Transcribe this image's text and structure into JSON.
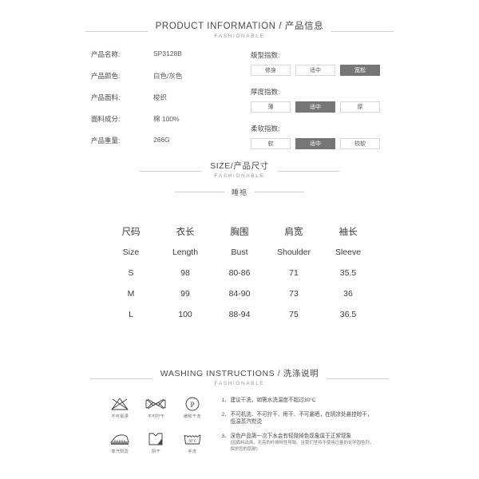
{
  "sections": {
    "product_information": {
      "title": "PRODUCT INFORMATION / 产品信息",
      "subtitle": "FASHIONABLE"
    },
    "size": {
      "title": "SIZE/产品尺寸",
      "subtitle": "FASHIONABLE",
      "type_name": "睡袍"
    },
    "washing": {
      "title": "WASHING INSTRUCTIONS / 洗涤说明",
      "subtitle": "FASHIONABLE"
    }
  },
  "product_info": [
    {
      "label": "产品名称:",
      "value": "SP3128B"
    },
    {
      "label": "产品颜色:",
      "value": "白色/灰色"
    },
    {
      "label": "产品面料:",
      "value": "梭织"
    },
    {
      "label": "面料成分:",
      "value": "棉 100%"
    },
    {
      "label": "产品重量:",
      "value": "266G"
    }
  ],
  "index_groups": [
    {
      "title": "版型指数:",
      "options": [
        {
          "label": "修身",
          "selected": false
        },
        {
          "label": "适中",
          "selected": false
        },
        {
          "label": "宽松",
          "selected": true
        }
      ]
    },
    {
      "title": "厚度指数:",
      "options": [
        {
          "label": "薄",
          "selected": false
        },
        {
          "label": "适中",
          "selected": true
        },
        {
          "label": "厚",
          "selected": false
        }
      ]
    },
    {
      "title": "柔软指数:",
      "options": [
        {
          "label": "软",
          "selected": false
        },
        {
          "label": "适中",
          "selected": true
        },
        {
          "label": "较软",
          "selected": false
        }
      ]
    }
  ],
  "size_table": {
    "headers_cn": [
      "尺码",
      "衣长",
      "胸围",
      "肩宽",
      "袖长"
    ],
    "headers_en": [
      "Size",
      "Length",
      "Bust",
      "Shoulder",
      "Sleeve"
    ],
    "rows": [
      [
        "S",
        "98",
        "80-86",
        "71",
        "35.5"
      ],
      [
        "M",
        "99",
        "84-90",
        "73",
        "36"
      ],
      [
        "L",
        "100",
        "88-94",
        "75",
        "36.5"
      ]
    ]
  },
  "care_icons": [
    {
      "name": "no-bleach-icon",
      "label": "不可氯漂"
    },
    {
      "name": "no-wring-icon",
      "label": "不可拧干"
    },
    {
      "name": "gentle-dry-clean-icon",
      "label": "缓和干洗"
    },
    {
      "name": "steam-iron-icon",
      "label": "蒸汽熨烫"
    },
    {
      "name": "shade-dry-icon",
      "label": "阴干"
    },
    {
      "name": "hand-wash-icon",
      "label": "手洗",
      "temp": "30°C"
    }
  ],
  "washing_notes": [
    {
      "num": "1、",
      "text": "建议干洗，如需水洗温度不超过30°C",
      "sub": ""
    },
    {
      "num": "2、",
      "text": "不可机洗、不可拧干、甩干、不可暴晒，在阴凉处悬挂晾干，低温蒸汽熨烫",
      "sub": ""
    },
    {
      "num": "3、",
      "text": "深色产品第一次下水会有轻微掉色现象属于正常现象",
      "sub": "(因面料出商、无亮的纤维特性导致。且我们坚持不使用过量的化学固色剂，保护您的肌肤)"
    }
  ],
  "colors": {
    "selected_bg": "#767676",
    "rule": "#d2d2d2",
    "text": "#4a4a4a"
  }
}
